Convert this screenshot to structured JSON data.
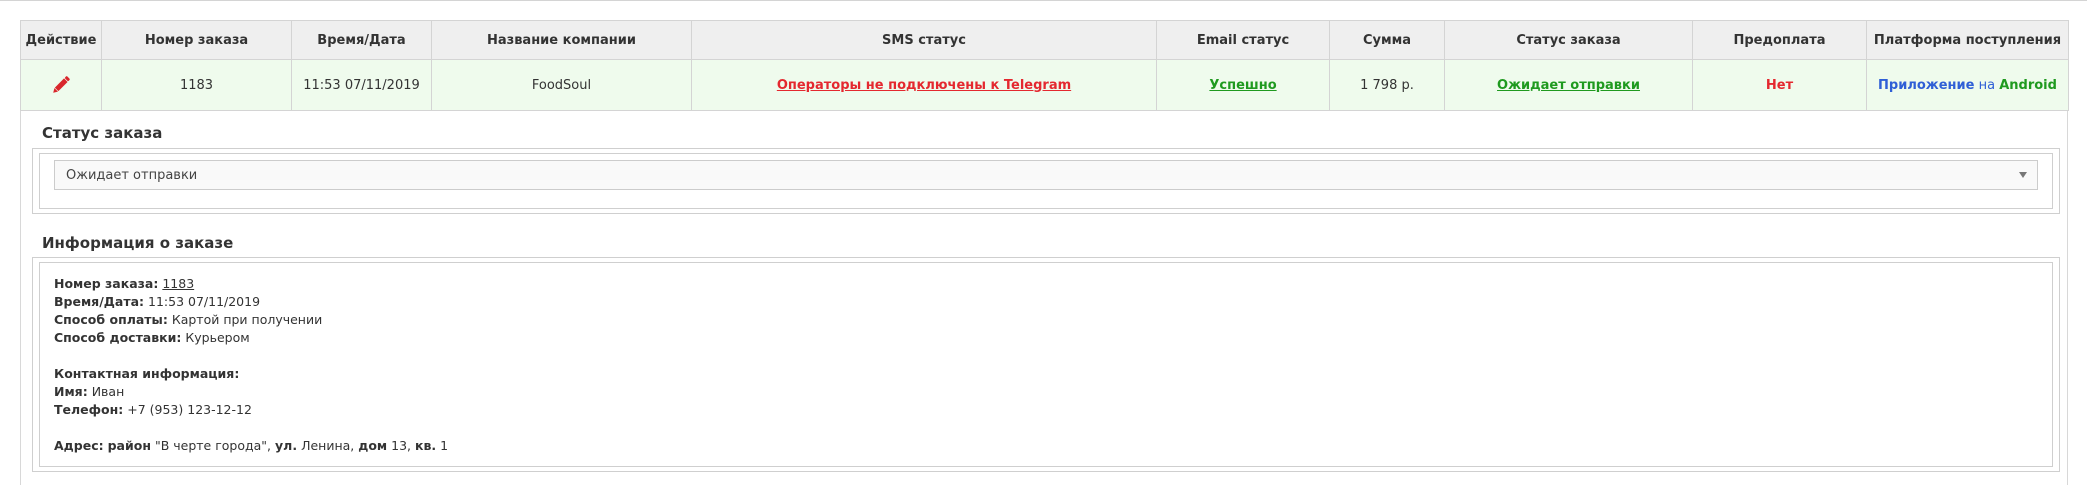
{
  "table": {
    "headers": [
      "Действие",
      "Номер заказа",
      "Время/Дата",
      "Название компании",
      "SMS статус",
      "Email статус",
      "Сумма",
      "Статус заказа",
      "Предоплата",
      "Платформа поступления"
    ],
    "row": {
      "action_icon": "pencil-icon",
      "order_number": "1183",
      "datetime": "11:53 07/11/2019",
      "company": "FoodSoul",
      "sms_status": "Операторы не подключены к Telegram",
      "email_status": "Успешно",
      "sum": "1 798 р.",
      "order_status": "Ожидает отправки",
      "prepayment": "Нет",
      "platform": {
        "app": "Приложение",
        "on": "на",
        "os": "Android"
      }
    }
  },
  "order_status_section": {
    "title": "Статус заказа",
    "selected": "Ожидает отправки"
  },
  "order_info_section": {
    "title": "Информация о заказе",
    "order_number_label": "Номер заказа:",
    "order_number": "1183",
    "datetime_label": "Время/Дата:",
    "datetime": "11:53 07/11/2019",
    "payment_label": "Способ оплаты:",
    "payment": "Картой при получении",
    "delivery_label": "Способ доставки:",
    "delivery": "Курьером",
    "contact_label": "Контактная информация:",
    "name_label": "Имя:",
    "name": "Иван",
    "phone_label": "Телефон:",
    "phone": "+7 (953) 123-12-12",
    "address_label": "Адрес:",
    "district_label": "район",
    "district": "\"В черте города\",",
    "street_label": "ул.",
    "street": "Ленина,",
    "house_label": "дом",
    "house": "13,",
    "apt_label": "кв.",
    "apt": "1"
  },
  "colors": {
    "header_bg": "#efefef",
    "row_bg": "#effbed",
    "error_red": "#e4282f",
    "success_green": "#1f9a1f",
    "link_blue": "#2f5fd6"
  }
}
